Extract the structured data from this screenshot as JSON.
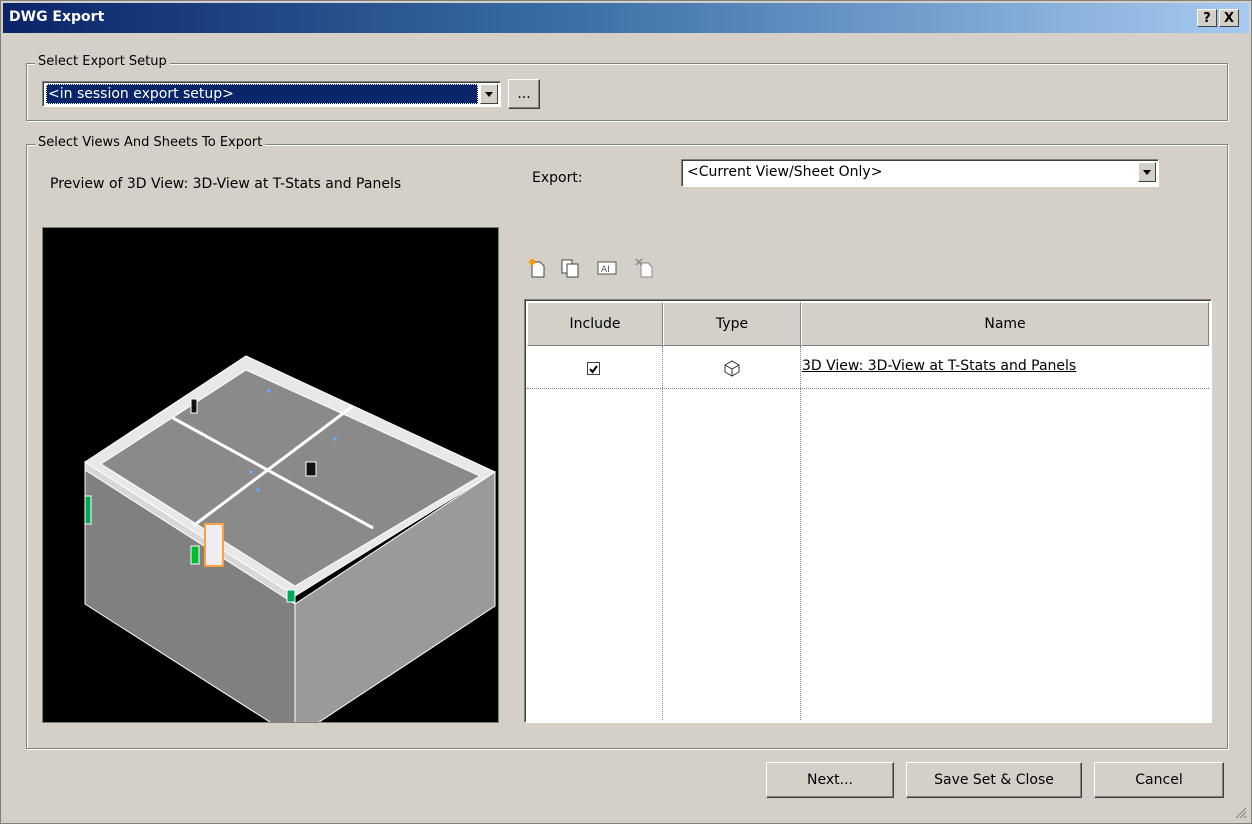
{
  "window": {
    "title": "DWG Export"
  },
  "title_buttons": {
    "help": "?",
    "close": "X"
  },
  "export_setup": {
    "legend": "Select Export Setup",
    "combo_value": "<in session export setup>",
    "browse_label": "..."
  },
  "views": {
    "legend": "Select Views And Sheets To Export",
    "preview_label": "Preview of 3D View: 3D-View at T-Stats and Panels",
    "export_label": "Export:",
    "export_value": "<Current View/Sheet Only>"
  },
  "table": {
    "columns": [
      "Include",
      "Type",
      "Name"
    ],
    "rows": [
      {
        "include": true,
        "type_icon": "3d-view-icon",
        "name": "3D View: 3D-View at T-Stats and Panels"
      }
    ]
  },
  "buttons": {
    "next": "Next...",
    "save_close": "Save Set & Close",
    "cancel": "Cancel"
  },
  "toolbar_icons": [
    "new-set-icon",
    "duplicate-set-icon",
    "rename-set-icon",
    "delete-set-icon"
  ],
  "colors": {
    "titlebar_start": "#0a246a",
    "titlebar_end": "#a6caf0",
    "face": "#d4d0c8",
    "selection": "#0a246a"
  }
}
